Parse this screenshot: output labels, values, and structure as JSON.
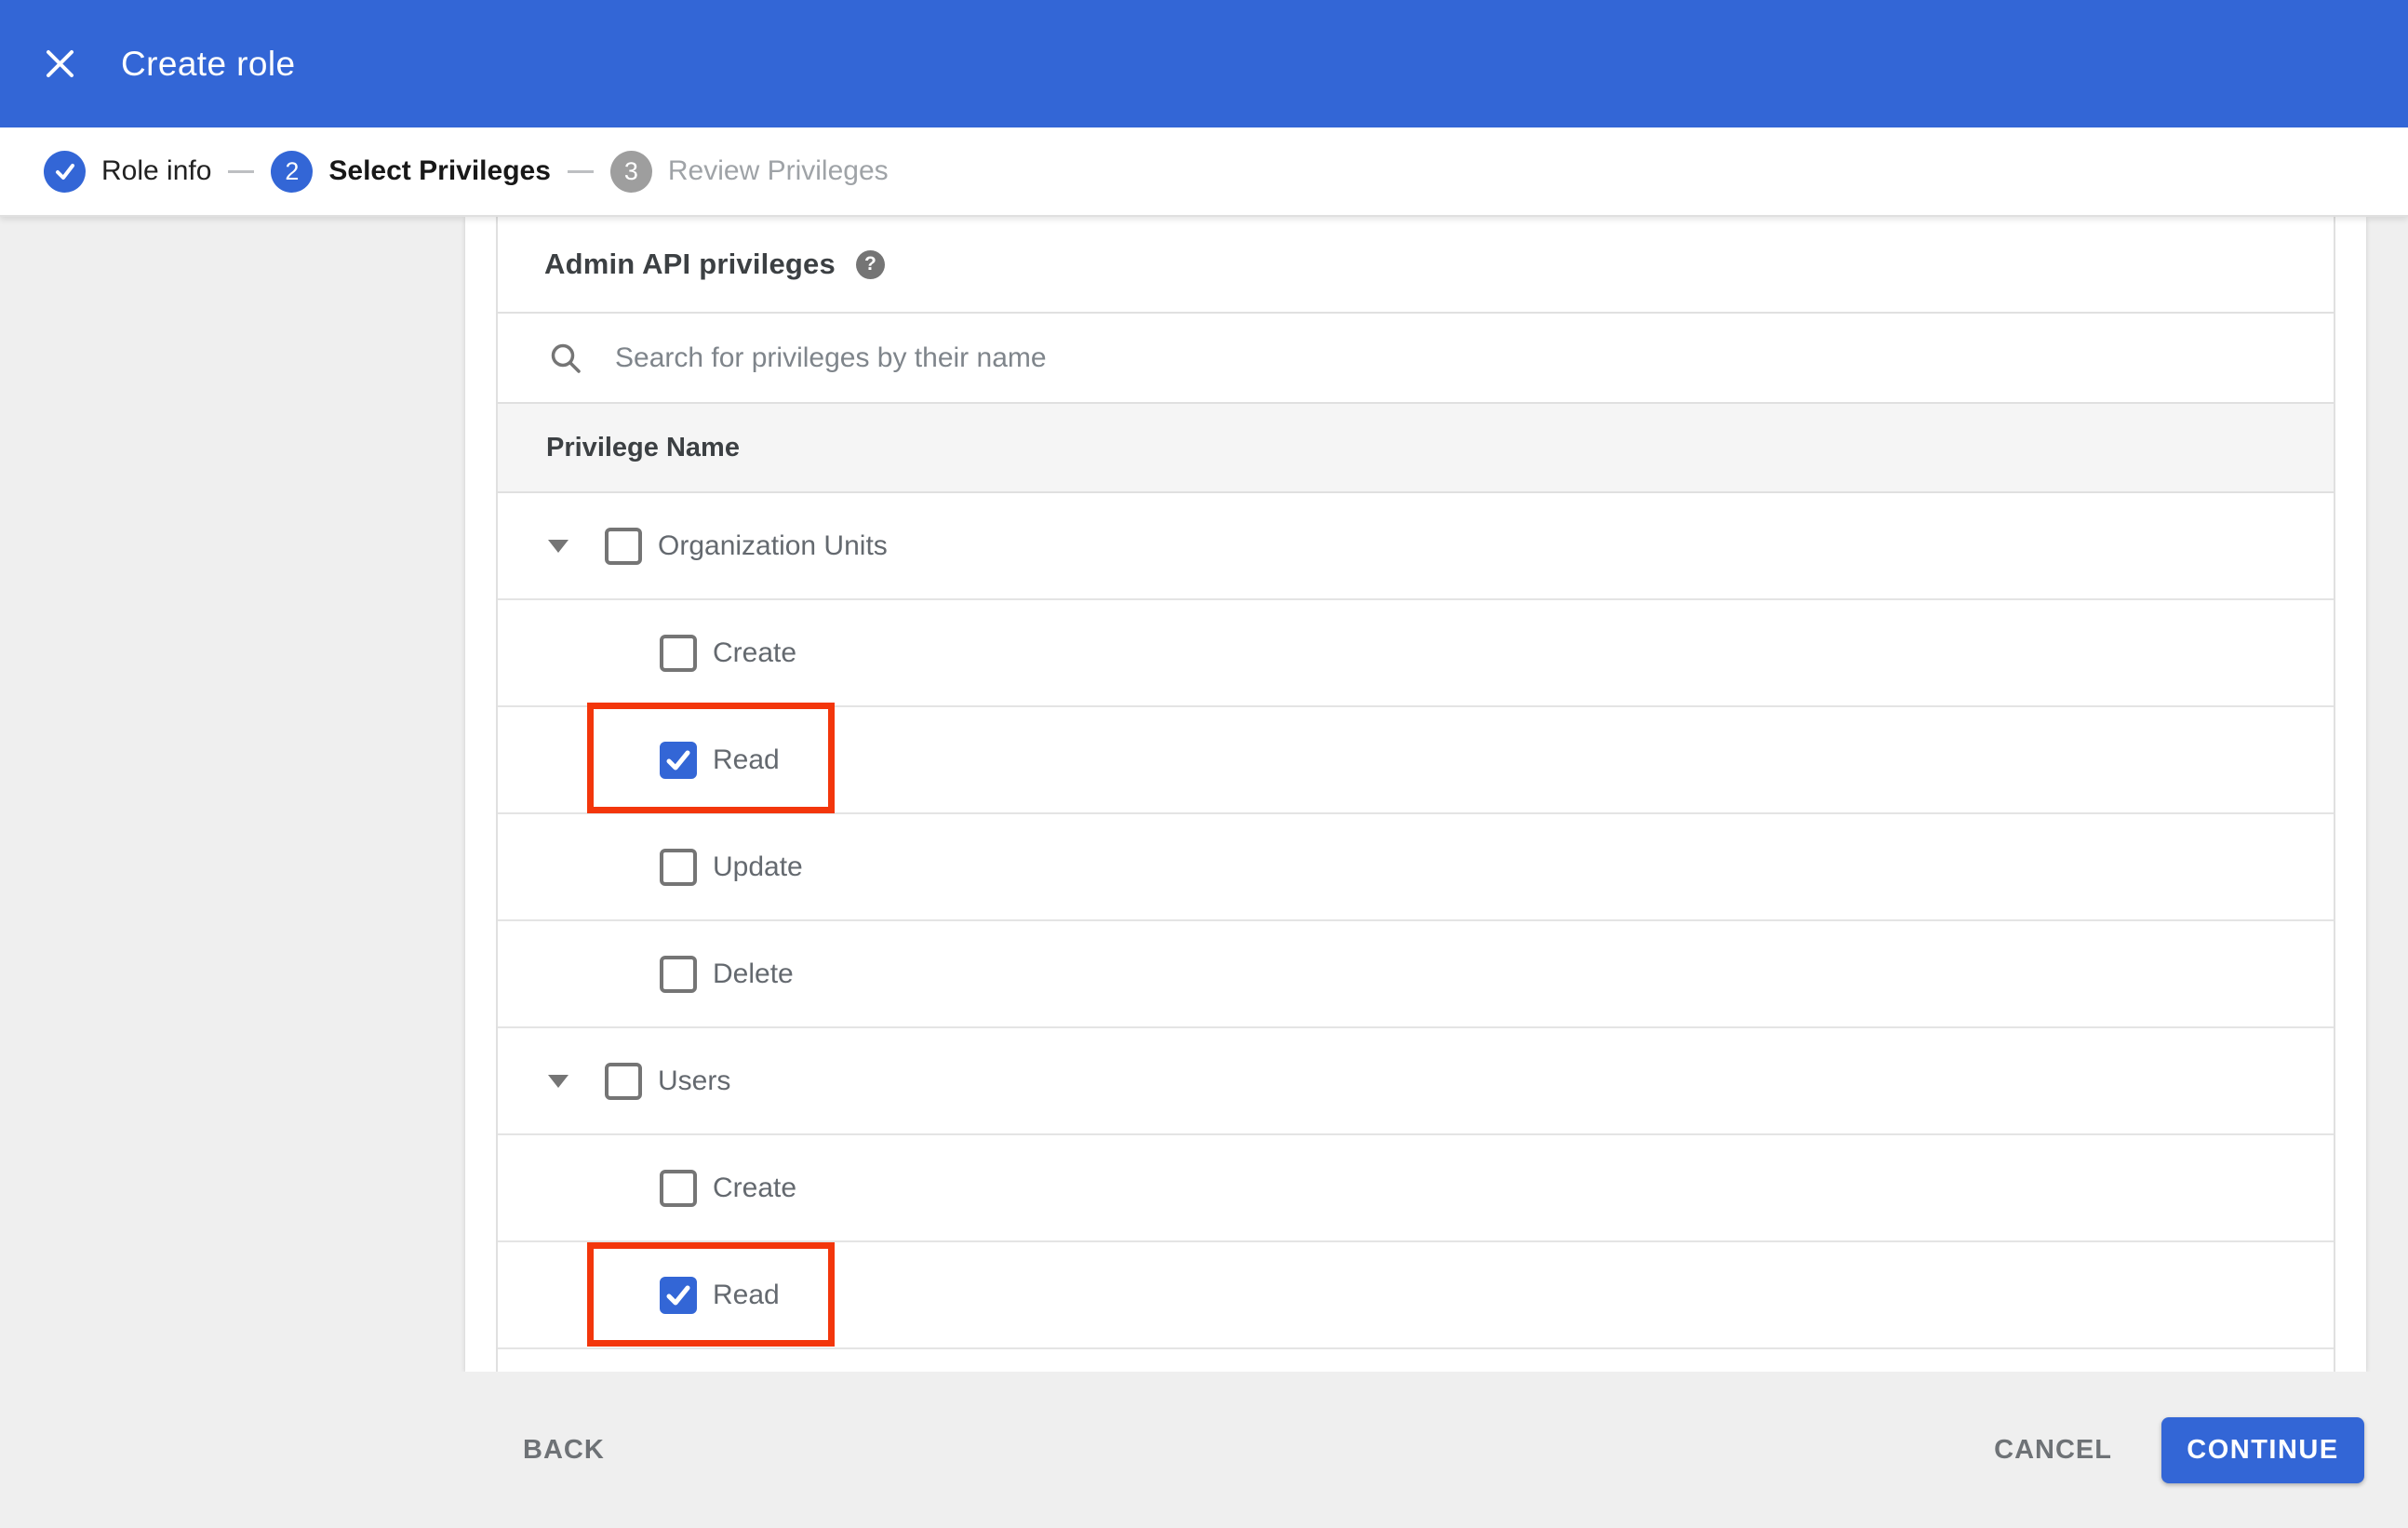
{
  "header": {
    "title": "Create role"
  },
  "stepper": {
    "steps": [
      {
        "number": "1",
        "label": "Role info",
        "state": "completed"
      },
      {
        "number": "2",
        "label": "Select Privileges",
        "state": "active"
      },
      {
        "number": "3",
        "label": "Review Privileges",
        "state": "upcoming"
      }
    ]
  },
  "content": {
    "section_title": "Admin API privileges",
    "help_icon": "?",
    "search": {
      "placeholder": "Search for privileges by their name",
      "value": ""
    },
    "table": {
      "column_header": "Privilege Name",
      "groups": [
        {
          "label": "Organization Units",
          "checked": false,
          "expanded": true,
          "children": [
            {
              "label": "Create",
              "checked": false,
              "highlighted": false
            },
            {
              "label": "Read",
              "checked": true,
              "highlighted": true
            },
            {
              "label": "Update",
              "checked": false,
              "highlighted": false
            },
            {
              "label": "Delete",
              "checked": false,
              "highlighted": false
            }
          ]
        },
        {
          "label": "Users",
          "checked": false,
          "expanded": true,
          "children": [
            {
              "label": "Create",
              "checked": false,
              "highlighted": false
            },
            {
              "label": "Read",
              "checked": true,
              "highlighted": true
            }
          ]
        }
      ]
    }
  },
  "footer": {
    "back_label": "BACK",
    "cancel_label": "CANCEL",
    "continue_label": "CONTINUE"
  },
  "colors": {
    "accent_blue": "#3366d6",
    "annotation_red": "#f3360b",
    "page_background": "#efefef",
    "table_header_bg": "#f5f5f5",
    "inactive_step_gray": "#9e9e9e"
  }
}
